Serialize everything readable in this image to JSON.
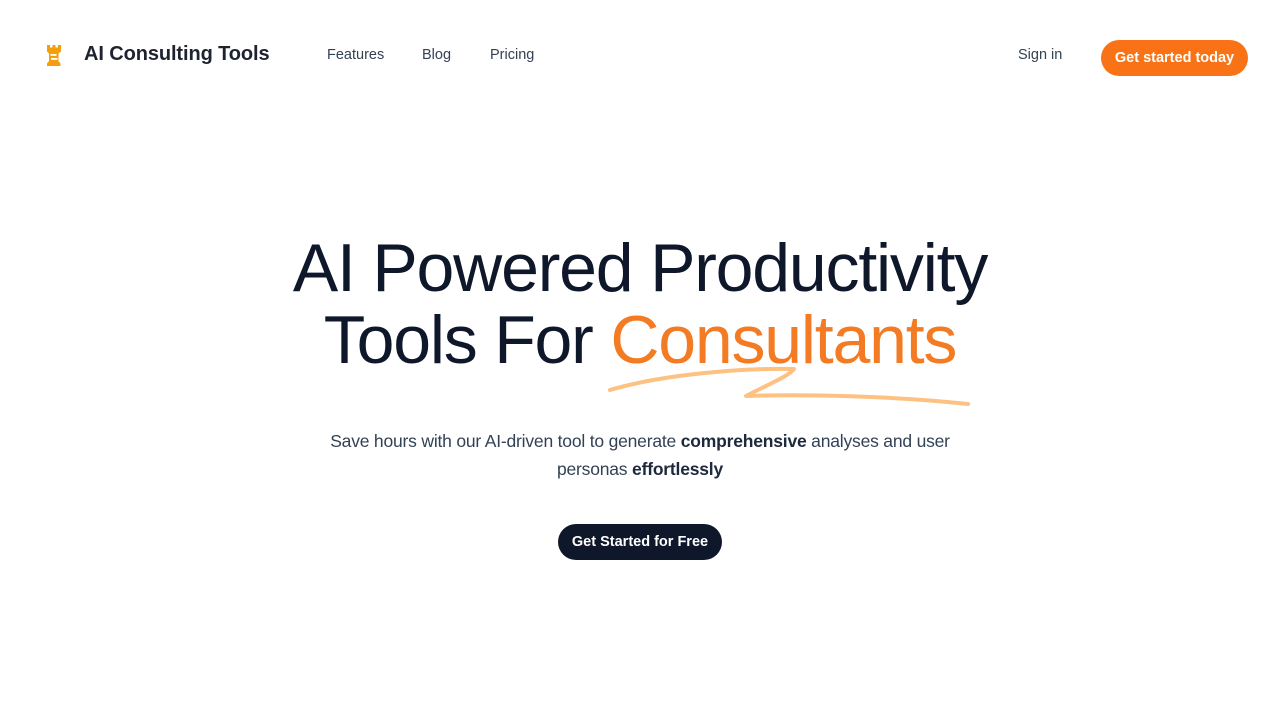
{
  "nav": {
    "logo_icon": "chess-rook-icon",
    "brand": "AI Consulting Tools",
    "links": [
      {
        "label": "Features"
      },
      {
        "label": "Blog"
      },
      {
        "label": "Pricing"
      }
    ],
    "sign_in": "Sign in",
    "cta": "Get started today"
  },
  "hero": {
    "title_line1": "AI Powered Productivity",
    "title_line2_prefix": "Tools For ",
    "title_accent": "Consultants",
    "subtitle": {
      "part1": "Save hours with our AI-driven tool to generate ",
      "bold1": "comprehensive",
      "part2": " analyses and user personas ",
      "bold2": "effortlessly"
    },
    "cta": "Get Started for Free"
  },
  "colors": {
    "accent": "#f97316",
    "accent_text": "#f27b23",
    "squiggle": "#fdba74",
    "logo": "#f59e0b",
    "dark": "#0f172a",
    "muted_text": "#334155"
  }
}
